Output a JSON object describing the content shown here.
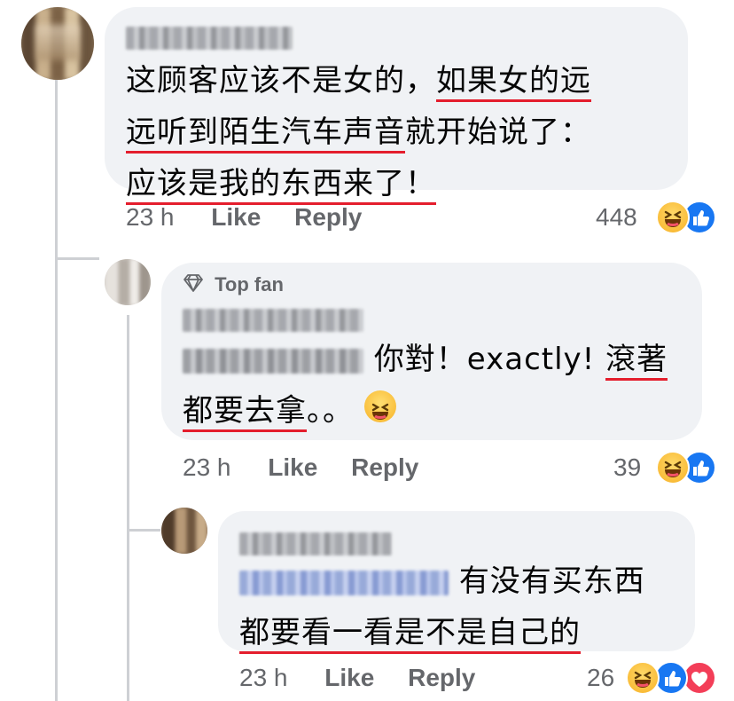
{
  "comment1": {
    "text_plain": "这顾客应该不是女的，",
    "text_underlined_1": "如果女的远",
    "text_line2_underlined": "远听到陌生汽车声音",
    "text_line2_plain": "就开始说了：",
    "text_line3_underlined": "应该是我的东西来了！",
    "time": "23 h",
    "like_label": "Like",
    "reply_label": "Reply",
    "reaction_count": "448"
  },
  "reply1": {
    "badge_label": "Top fan",
    "text_plain": "你對！exactly!",
    "text_underlined_1": "滾著",
    "text_line2_underlined": "都要去拿",
    "text_line2_plain": "。。",
    "time": "23 h",
    "like_label": "Like",
    "reply_label": "Reply",
    "reaction_count": "39"
  },
  "reply2": {
    "text_plain": "有没有买东西",
    "text_line2_underlined": "都要看一看是不是自己的",
    "time": "23 h",
    "like_label": "Like",
    "reply_label": "Reply",
    "reaction_count": "26"
  },
  "colors": {
    "bubble": "#f0f2f5",
    "meta_text": "#65676b",
    "underline": "#e41e2d",
    "like_blue": "#1877f2",
    "love_red": "#f33e58"
  }
}
